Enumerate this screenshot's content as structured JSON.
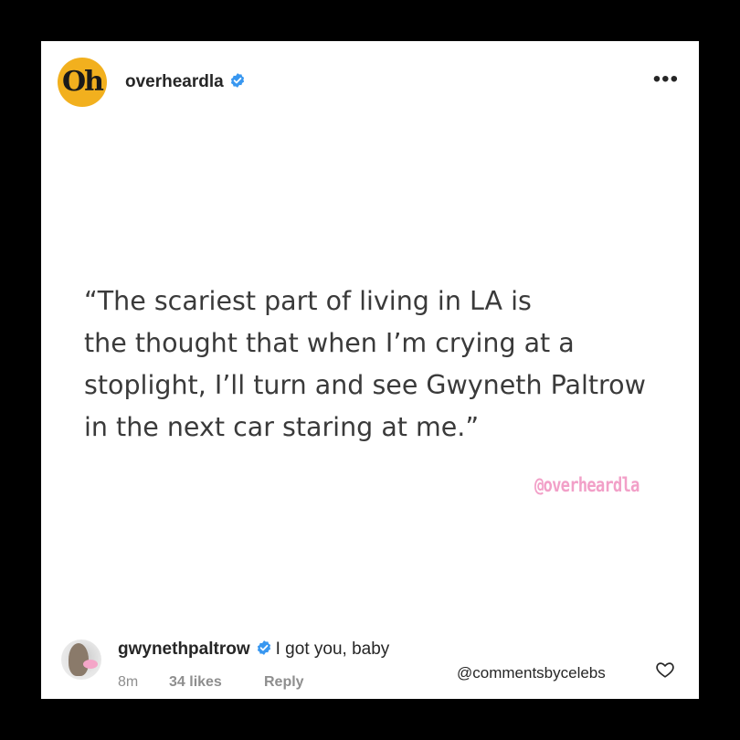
{
  "post": {
    "avatar_text": "Oh",
    "username": "overheardla",
    "verified": true,
    "more_label": "•••"
  },
  "quote": {
    "text": "“The scariest part of living in LA is\nthe thought that when I’m crying at a\nstoplight, I’ll turn and see Gwyneth Paltrow\nin the next car staring at me.”",
    "watermark": "@overheardla"
  },
  "comment": {
    "username": "gwynethpaltrow",
    "verified": true,
    "text": "I got you, baby",
    "time": "8m",
    "likes": "34 likes",
    "reply_label": "Reply"
  },
  "credit": "@commentsbyceleb s",
  "colors": {
    "background": "#000000",
    "card": "#ffffff",
    "avatar_bg": "#f2b01e",
    "verified": "#3897f0",
    "watermark": "#f2a0c8",
    "meta_text": "#8e8e8e"
  },
  "icons": {
    "verified": "verified-badge-icon",
    "more": "more-options-icon",
    "heart": "heart-outline-icon"
  }
}
